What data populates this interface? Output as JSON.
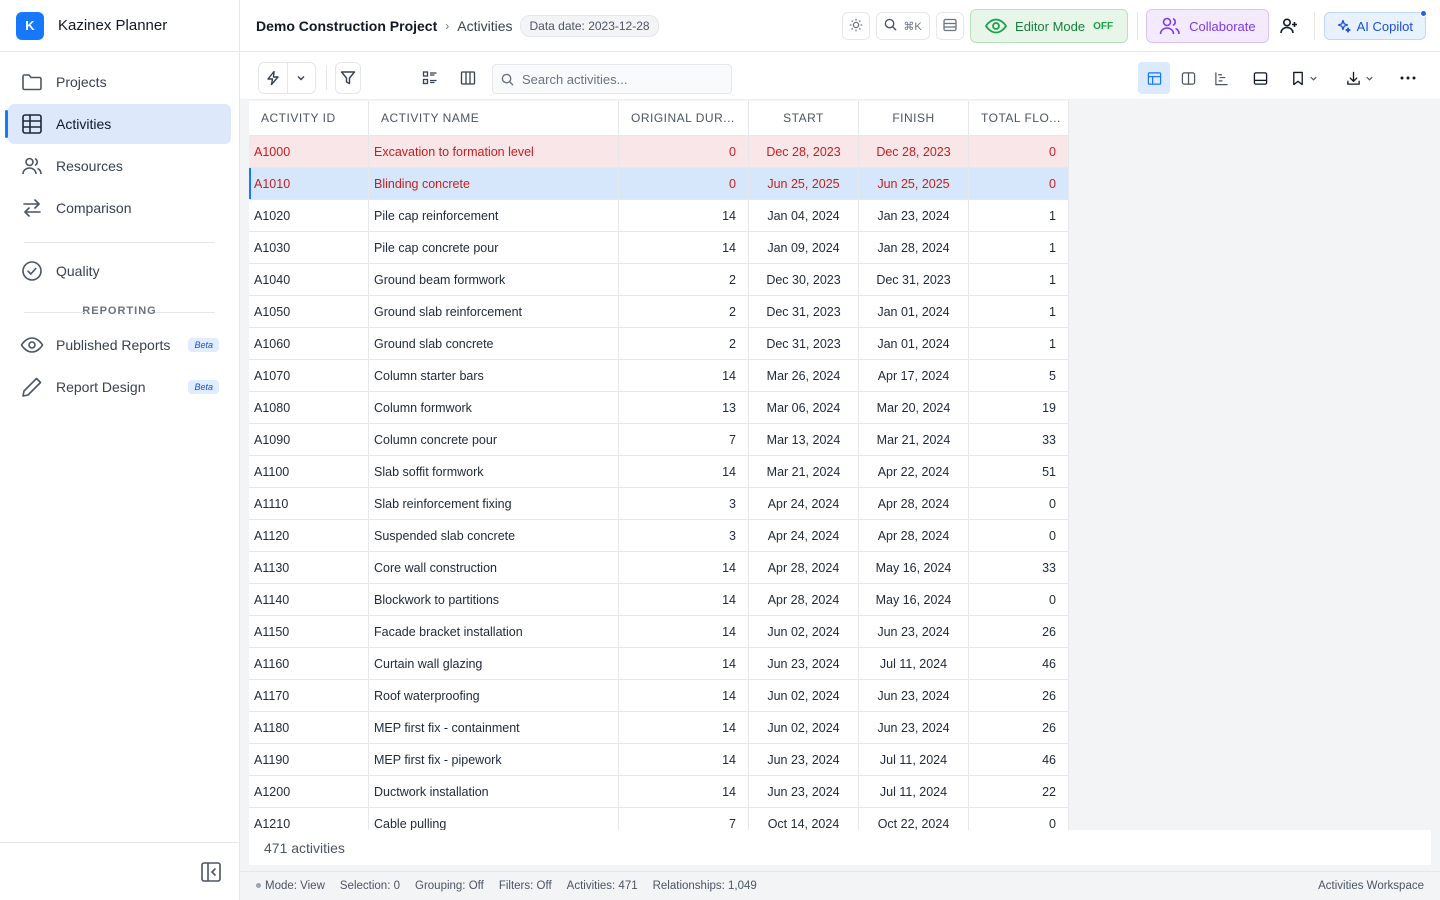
{
  "app": {
    "logo_letter": "K",
    "name": "Kazinex Planner"
  },
  "sidebar": {
    "items": [
      {
        "label": "Projects",
        "icon": "folder-icon"
      },
      {
        "label": "Activities",
        "icon": "table-icon",
        "active": true
      },
      {
        "label": "Resources",
        "icon": "users-icon"
      },
      {
        "label": "Comparison",
        "icon": "swap-arrows-icon"
      }
    ],
    "quality_label": "Quality",
    "reporting_heading": "REPORTING",
    "reports": [
      {
        "label": "Published Reports",
        "badge": "Beta"
      },
      {
        "label": "Report Design",
        "badge": "Beta"
      }
    ]
  },
  "header": {
    "project": "Demo Construction Project",
    "separator": "›",
    "page": "Activities",
    "data_date": "Data date: 2023-12-28",
    "search_shortcut": "⌘K",
    "editor_mode_label": "Editor Mode",
    "editor_mode_state": "OFF",
    "collaborate_label": "Collaborate",
    "ai_label": "AI Copilot"
  },
  "toolbar": {
    "search_placeholder": "Search activities..."
  },
  "table": {
    "columns": [
      "ACTIVITY ID",
      "ACTIVITY NAME",
      "ORIGINAL DUR...",
      "START",
      "FINISH",
      "TOTAL FLO..."
    ],
    "rows": [
      [
        "A1000",
        "Excavation to formation level",
        "0",
        "Dec 28, 2023",
        "Dec 28, 2023",
        "0"
      ],
      [
        "A1010",
        "Blinding concrete",
        "0",
        "Jun 25, 2025",
        "Jun 25, 2025",
        "0"
      ],
      [
        "A1020",
        "Pile cap reinforcement",
        "14",
        "Jan 04, 2024",
        "Jan 23, 2024",
        "1"
      ],
      [
        "A1030",
        "Pile cap concrete pour",
        "14",
        "Jan 09, 2024",
        "Jan 28, 2024",
        "1"
      ],
      [
        "A1040",
        "Ground beam formwork",
        "2",
        "Dec 30, 2023",
        "Dec 31, 2023",
        "1"
      ],
      [
        "A1050",
        "Ground slab reinforcement",
        "2",
        "Dec 31, 2023",
        "Jan 01, 2024",
        "1"
      ],
      [
        "A1060",
        "Ground slab concrete",
        "2",
        "Dec 31, 2023",
        "Jan 01, 2024",
        "1"
      ],
      [
        "A1070",
        "Column starter bars",
        "14",
        "Mar 26, 2024",
        "Apr 17, 2024",
        "5"
      ],
      [
        "A1080",
        "Column formwork",
        "13",
        "Mar 06, 2024",
        "Mar 20, 2024",
        "19"
      ],
      [
        "A1090",
        "Column concrete pour",
        "7",
        "Mar 13, 2024",
        "Mar 21, 2024",
        "33"
      ],
      [
        "A1100",
        "Slab soffit formwork",
        "14",
        "Mar 21, 2024",
        "Apr 22, 2024",
        "51"
      ],
      [
        "A1110",
        "Slab reinforcement fixing",
        "3",
        "Apr 24, 2024",
        "Apr 28, 2024",
        "0"
      ],
      [
        "A1120",
        "Suspended slab concrete",
        "3",
        "Apr 24, 2024",
        "Apr 28, 2024",
        "0"
      ],
      [
        "A1130",
        "Core wall construction",
        "14",
        "Apr 28, 2024",
        "May 16, 2024",
        "33"
      ],
      [
        "A1140",
        "Blockwork to partitions",
        "14",
        "Apr 28, 2024",
        "May 16, 2024",
        "0"
      ],
      [
        "A1150",
        "Facade bracket installation",
        "14",
        "Jun 02, 2024",
        "Jun 23, 2024",
        "26"
      ],
      [
        "A1160",
        "Curtain wall glazing",
        "14",
        "Jun 23, 2024",
        "Jul 11, 2024",
        "46"
      ],
      [
        "A1170",
        "Roof waterproofing",
        "14",
        "Jun 02, 2024",
        "Jun 23, 2024",
        "26"
      ],
      [
        "A1180",
        "MEP first fix - containment",
        "14",
        "Jun 02, 2024",
        "Jun 23, 2024",
        "26"
      ],
      [
        "A1190",
        "MEP first fix - pipework",
        "14",
        "Jun 23, 2024",
        "Jul 11, 2024",
        "46"
      ],
      [
        "A1200",
        "Ductwork installation",
        "14",
        "Jun 23, 2024",
        "Jul 11, 2024",
        "22"
      ],
      [
        "A1210",
        "Cable pulling",
        "7",
        "Oct 14, 2024",
        "Oct 22, 2024",
        "0"
      ]
    ],
    "footer_count": "471 activities"
  },
  "statusbar": {
    "mode": "Mode: View",
    "selection": "Selection: 0",
    "grouping": "Grouping: Off",
    "filters": "Filters: Off",
    "activities": "Activities: 471",
    "relationships": "Relationships: 1,049",
    "workspace": "Activities Workspace"
  },
  "colors": {
    "accent": "#1677ff",
    "critical_text": "#c81e1e",
    "critical_row": "#f9e6e8",
    "selected_row": "#d6e6fb"
  }
}
